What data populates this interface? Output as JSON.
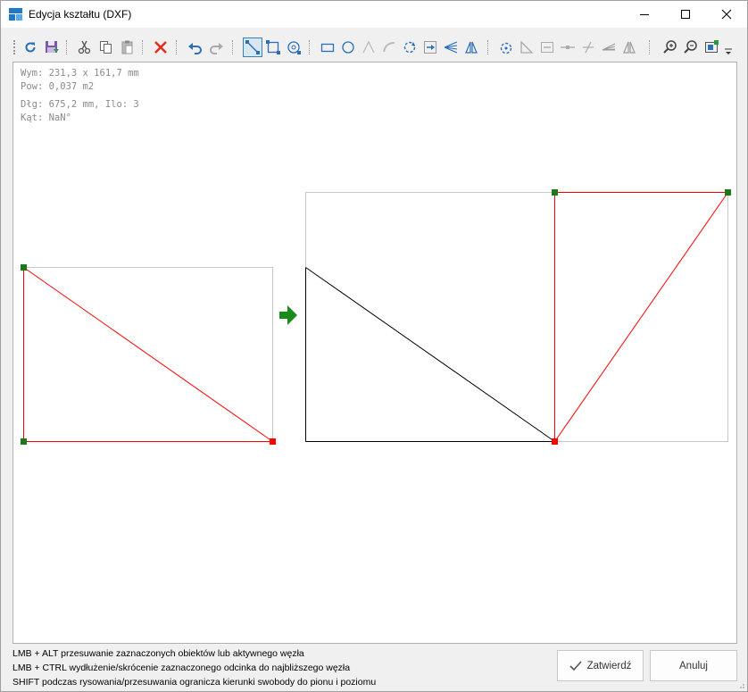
{
  "window": {
    "title": "Edycja kształtu (DXF)"
  },
  "toolbar": {
    "icons": [
      "refresh-icon",
      "save-icon",
      "cut-icon",
      "copy-icon",
      "paste-icon",
      "delete-icon",
      "undo-icon",
      "redo-icon",
      "select-segment-icon",
      "select-rect-icon",
      "select-circle-icon",
      "draw-rectangle-icon",
      "draw-circle-icon",
      "draw-line-icon",
      "draw-arc-icon",
      "rotate-icon",
      "align-icon",
      "fan-icon",
      "mirror-icon",
      "rotate-shape-icon",
      "corner-icon",
      "extend-icon",
      "split-icon",
      "trim-icon",
      "array-icon",
      "mirror-shape-icon",
      "zoom-in-icon",
      "zoom-out-icon",
      "fit-view-icon",
      "overflow-icon"
    ]
  },
  "info": {
    "dimensions": "Wym: 231,3 x 161,7 mm",
    "area": "Pow: 0,037 m2",
    "length": "Dłg: 675,2 mm, Ilo: 3",
    "angle": "Kąt: NaN°"
  },
  "hints": {
    "line1": "LMB + ALT przesuwanie zaznaczonych obiektów lub aktywnego węzła",
    "line2": "LMB + CTRL wydłużenie/skrócenie zaznaczonego odcinka do najbliższego węzła",
    "line3": "SHIFT podczas rysowania/przesuwania ogranicza kierunki swobody do pionu i poziomu"
  },
  "buttons": {
    "confirm": "Zatwierdź",
    "cancel": "Anuluj"
  },
  "colors": {
    "selected_line": "#ff0000",
    "node_active": "#1a7a1a",
    "node_end": "#ff0000",
    "arrow": "#1a8a1a",
    "bbox": "#c8c8c8",
    "shape": "#000000"
  }
}
